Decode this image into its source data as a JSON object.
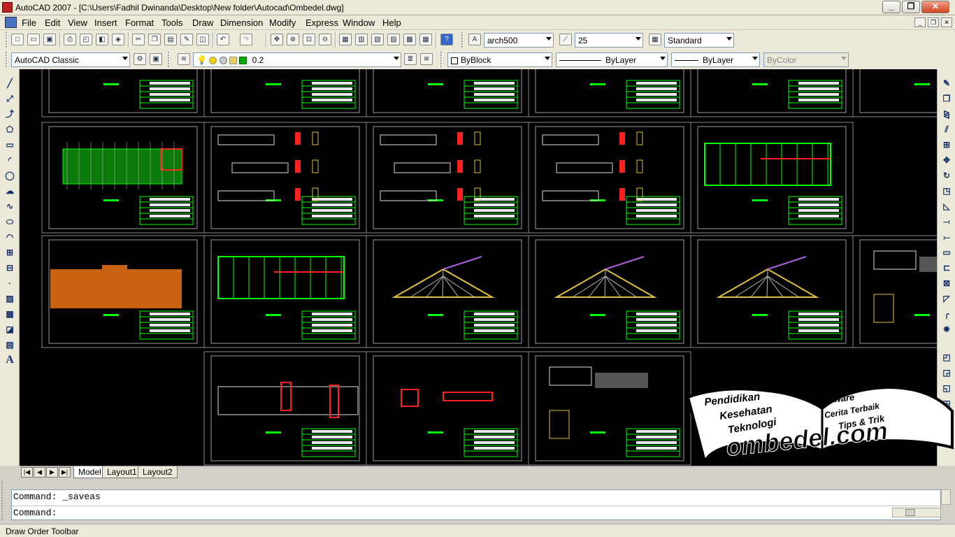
{
  "window": {
    "title": "AutoCAD 2007 - [C:\\Users\\Fadhil Dwinanda\\Desktop\\New folder\\Autocad\\Ombedel.dwg]",
    "minimize_glyph": "_",
    "restore_glyph": "❐",
    "close_glyph": "✕"
  },
  "menu": {
    "items": [
      "File",
      "Edit",
      "View",
      "Insert",
      "Format",
      "Tools",
      "Draw",
      "Dimension",
      "Modify",
      "Express",
      "Window",
      "Help"
    ]
  },
  "standard_toolbar": {
    "text_style": "arch500",
    "dim_style": "25",
    "table_style": "Standard"
  },
  "workspace_toolbar": {
    "workspace": "AutoCAD Classic",
    "layer": "0.2",
    "color": "ByBlock",
    "linetype": "ByLayer",
    "lineweight": "ByLayer",
    "plotstyle": "ByColor"
  },
  "layout_tabs": [
    "Model",
    "Layout1",
    "Layout2"
  ],
  "command_line": {
    "history": "Command:  _saveas",
    "prompt": "Command:"
  },
  "status": {
    "text": "Draw Order Toolbar"
  },
  "watermark": {
    "left_page": [
      "Pendidikan",
      "Kesehatan",
      "Teknologi"
    ],
    "right_page": [
      "Software",
      "Cerita Terbaik",
      "Tips & Trik"
    ],
    "site": "ombedel.com"
  },
  "colors": {
    "drawing_bg": "#000000",
    "accent_green": "#00ff00",
    "accent_red": "#ff2020",
    "accent_orange": "#c8620e",
    "accent_yellow": "#e0c040"
  }
}
